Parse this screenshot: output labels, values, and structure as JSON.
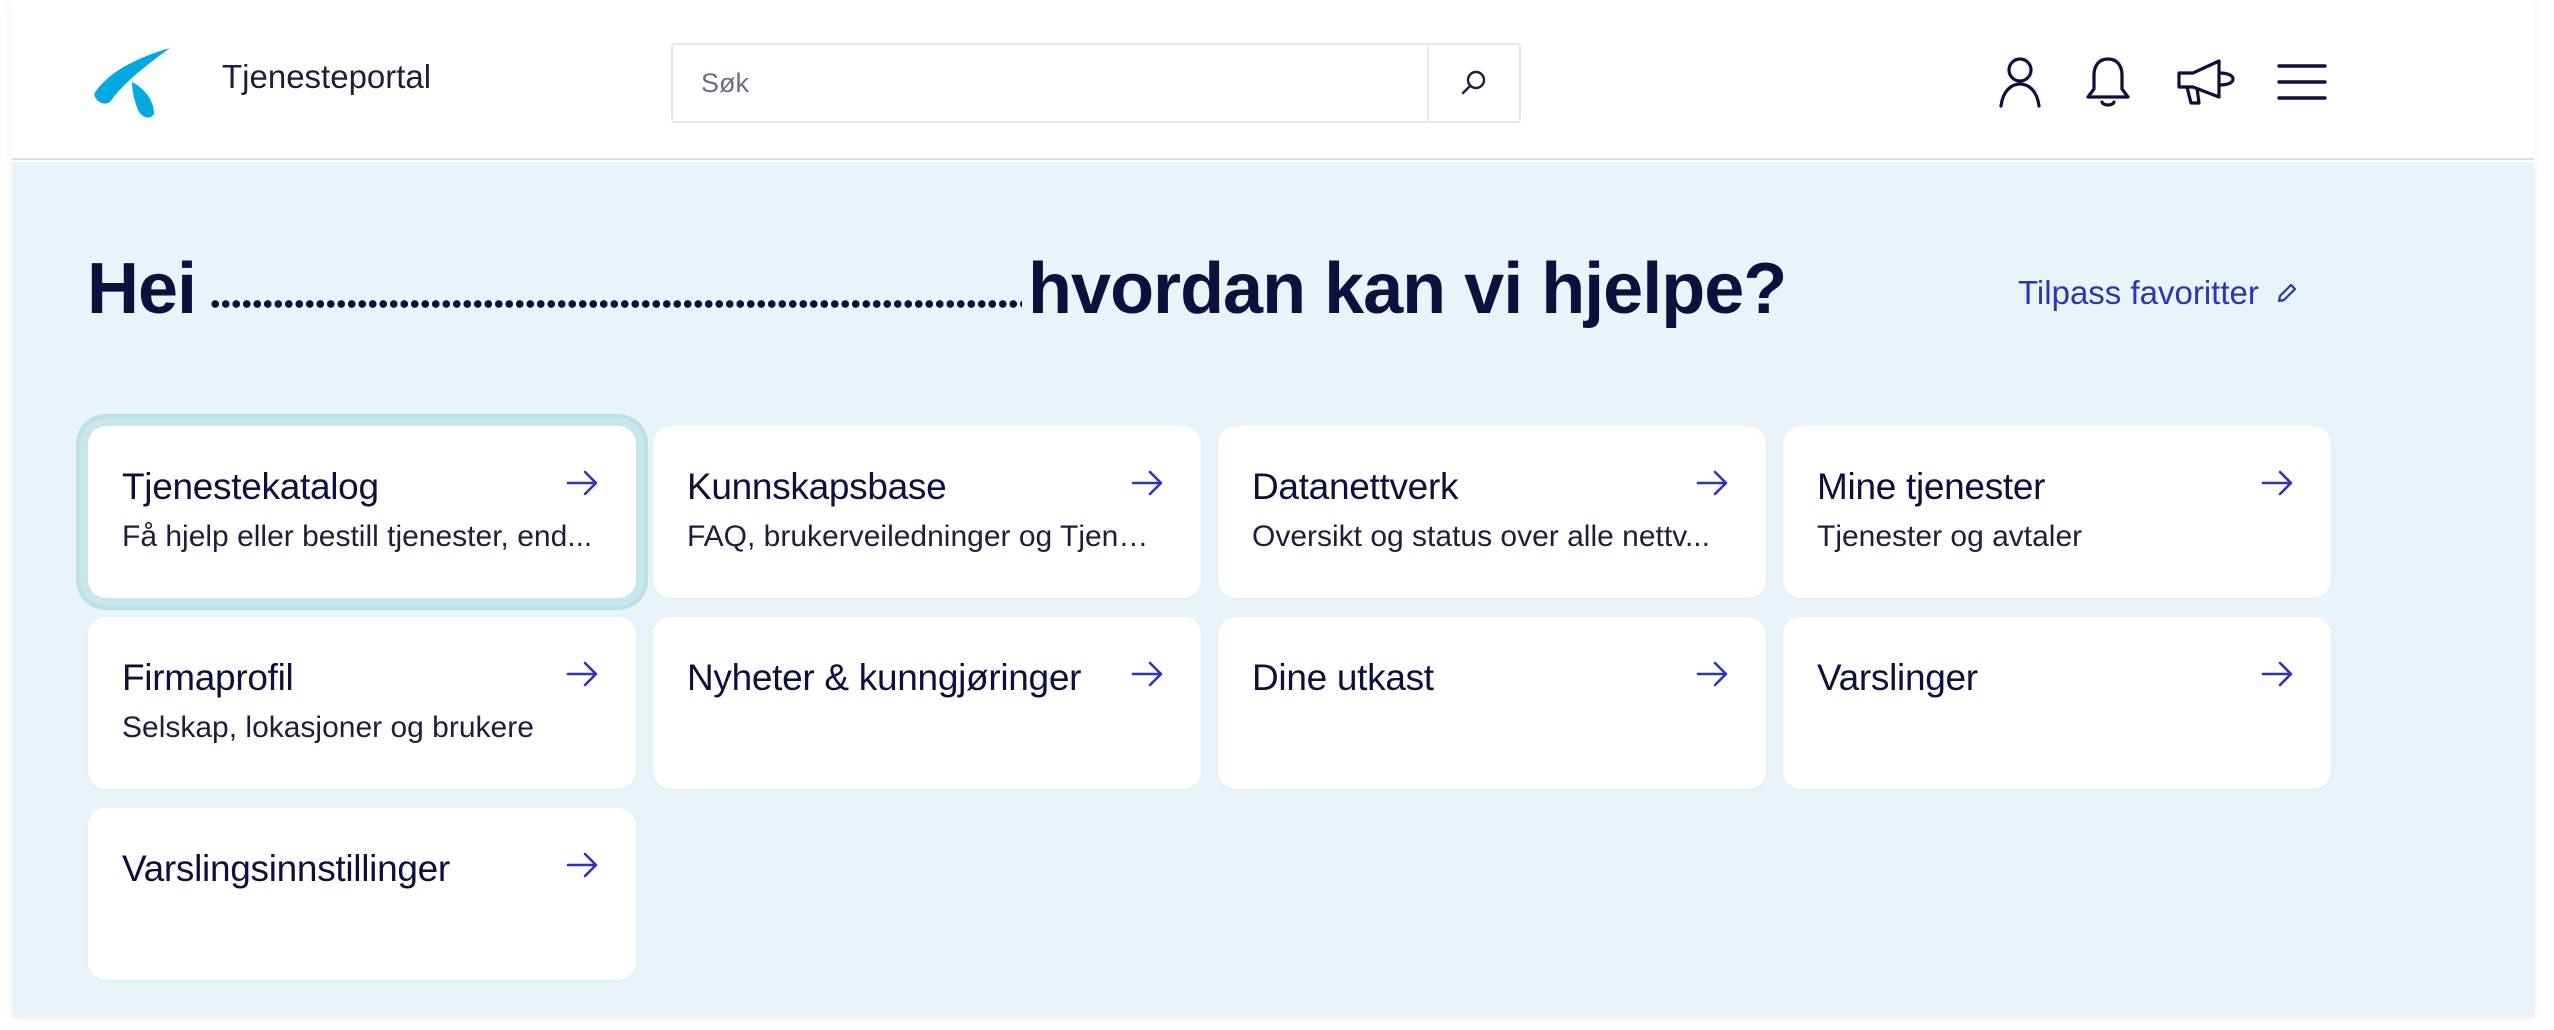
{
  "header": {
    "portal_title": "Tjenesteportal",
    "search_placeholder": "Søk",
    "search_value": "",
    "icons": [
      "user-icon",
      "bell-icon",
      "megaphone-icon",
      "hamburger-menu-icon"
    ]
  },
  "greeting": {
    "hello": "Hei",
    "question": "hvordan kan vi hjelpe?"
  },
  "customize_label": "Tilpass favoritter",
  "cards": [
    {
      "title": "Tjenestekatalog",
      "description": "Få hjelp eller bestill tjenester, end..."
    },
    {
      "title": "Kunnskapsbase",
      "description": "FAQ, brukerveiledninger og Tjene..."
    },
    {
      "title": "Datanettverk",
      "description": "Oversikt og status over alle nettv..."
    },
    {
      "title": "Mine tjenester",
      "description": "Tjenester og avtaler"
    },
    {
      "title": "Firmaprofil",
      "description": "Selskap, lokasjoner og brukere"
    },
    {
      "title": "Nyheter & kunngjøringer",
      "description": ""
    },
    {
      "title": "Dine utkast",
      "description": ""
    },
    {
      "title": "Varslinger",
      "description": ""
    },
    {
      "title": "Varslingsinnstillinger",
      "description": ""
    }
  ],
  "colors": {
    "brand_blue": "#00a9e0",
    "accent": "#2c35b8",
    "text": "#0e0f3d",
    "background": "#e8f4f9",
    "focus_ring": "#c8e6ee"
  }
}
